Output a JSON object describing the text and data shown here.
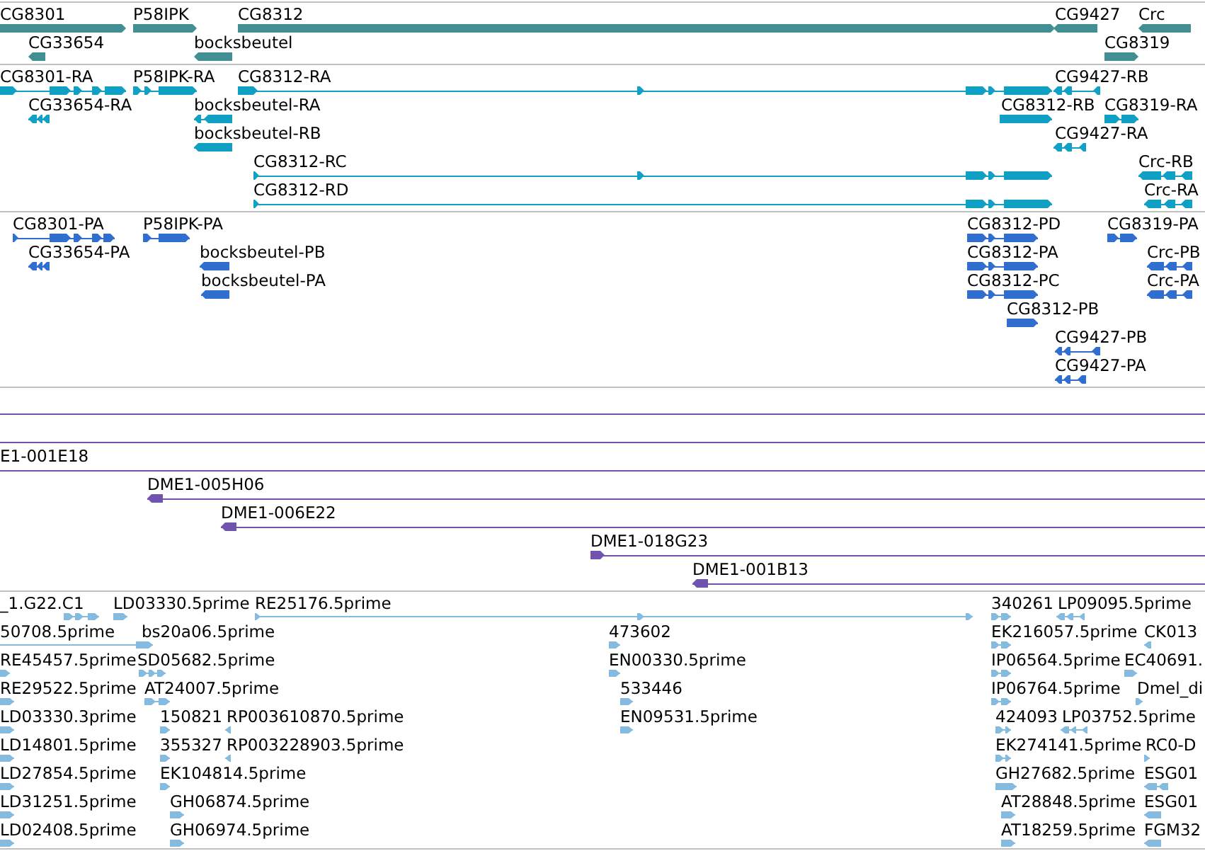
{
  "tracks": [
    {
      "kind": "gene",
      "color": "#418f92",
      "features": [
        {
          "label": "CG8301",
          "reverse": false
        },
        {
          "label": "P58IPK",
          "reverse": false
        },
        {
          "label": "CG8312",
          "reverse": false
        },
        {
          "label": "CG9427",
          "reverse": true
        },
        {
          "label": "Crc",
          "reverse": true
        },
        {
          "label": "CG33654",
          "reverse": true
        },
        {
          "label": "bocksbeutel",
          "reverse": true
        },
        {
          "label": "CG8319",
          "reverse": false
        }
      ]
    },
    {
      "kind": "transcript",
      "color": "#10a0c4",
      "features": [
        {
          "label": "CG8301-RA",
          "reverse": false
        },
        {
          "label": "P58IPK-RA",
          "reverse": false
        },
        {
          "label": "CG8312-RA",
          "reverse": false
        },
        {
          "label": "CG9427-RB",
          "reverse": true
        },
        {
          "label": "CG33654-RA",
          "reverse": true
        },
        {
          "label": "bocksbeutel-RA",
          "reverse": true
        },
        {
          "label": "CG8312-RB",
          "reverse": false
        },
        {
          "label": "CG8319-RA",
          "reverse": false
        },
        {
          "label": "bocksbeutel-RB",
          "reverse": true
        },
        {
          "label": "CG9427-RA",
          "reverse": true
        },
        {
          "label": "CG8312-RC",
          "reverse": false
        },
        {
          "label": "Crc-RB",
          "reverse": true
        },
        {
          "label": "CG8312-RD",
          "reverse": false
        },
        {
          "label": "Crc-RA",
          "reverse": true
        }
      ]
    },
    {
      "kind": "protein",
      "color": "#306ed0",
      "features": [
        {
          "label": "CG8301-PA",
          "reverse": false
        },
        {
          "label": "P58IPK-PA",
          "reverse": false
        },
        {
          "label": "CG8312-PD",
          "reverse": false
        },
        {
          "label": "CG8319-PA",
          "reverse": false
        },
        {
          "label": "CG33654-PA",
          "reverse": true
        },
        {
          "label": "bocksbeutel-PB",
          "reverse": true
        },
        {
          "label": "CG8312-PA",
          "reverse": false
        },
        {
          "label": "Crc-PB",
          "reverse": true
        },
        {
          "label": "bocksbeutel-PA",
          "reverse": true
        },
        {
          "label": "CG8312-PC",
          "reverse": false
        },
        {
          "label": "Crc-PA",
          "reverse": true
        },
        {
          "label": "CG8312-PB",
          "reverse": false
        },
        {
          "label": "CG9427-PB",
          "reverse": true
        },
        {
          "label": "CG9427-PA",
          "reverse": true
        }
      ]
    },
    {
      "kind": "clone",
      "color": "#7054b0",
      "features": [
        {
          "label": "E1-001E18"
        },
        {
          "label": "DME1-005H06",
          "reverse": true
        },
        {
          "label": "DME1-006E22",
          "reverse": true
        },
        {
          "label": "DME1-018G23",
          "reverse": false
        },
        {
          "label": "DME1-001B13",
          "reverse": true
        }
      ]
    },
    {
      "kind": "est",
      "color": "#86bbe0",
      "features": [
        {
          "label": "_1.G22.C1",
          "reverse": false
        },
        {
          "label": "LD03330.5prime",
          "reverse": false
        },
        {
          "label": "RE25176.5prime",
          "reverse": false
        },
        {
          "label": "340261",
          "reverse": false
        },
        {
          "label": "LP09095.5prime",
          "reverse": true
        },
        {
          "label": "50708.5prime",
          "reverse": false
        },
        {
          "label": "bs20a06.5prime"
        },
        {
          "label": "473602",
          "reverse": false
        },
        {
          "label": "EK216057.5prime",
          "reverse": false
        },
        {
          "label": "CK013",
          "reverse": true
        },
        {
          "label": "RE45457.5prime",
          "reverse": false
        },
        {
          "label": "SD05682.5prime",
          "reverse": false
        },
        {
          "label": "EN00330.5prime",
          "reverse": false
        },
        {
          "label": "IP06564.5prime",
          "reverse": false
        },
        {
          "label": "EC40691.",
          "reverse": false
        },
        {
          "label": "RE29522.5prime",
          "reverse": false
        },
        {
          "label": "AT24007.5prime",
          "reverse": false
        },
        {
          "label": "533446",
          "reverse": false
        },
        {
          "label": "IP06764.5prime",
          "reverse": false
        },
        {
          "label": "Dmel_di",
          "reverse": false
        },
        {
          "label": "LD03330.3prime",
          "reverse": false
        },
        {
          "label": "150821",
          "reverse": false
        },
        {
          "label": "RP003610870.5prime",
          "reverse": true
        },
        {
          "label": "EN09531.5prime",
          "reverse": false
        },
        {
          "label": "424093",
          "reverse": false
        },
        {
          "label": "LP03752.5prime",
          "reverse": true
        },
        {
          "label": "LD14801.5prime",
          "reverse": false
        },
        {
          "label": "355327",
          "reverse": false
        },
        {
          "label": "RP003228903.5prime",
          "reverse": true
        },
        {
          "label": "EK274141.5prime",
          "reverse": false
        },
        {
          "label": "RC0-D",
          "reverse": false
        },
        {
          "label": "LD27854.5prime",
          "reverse": false
        },
        {
          "label": "EK104814.5prime",
          "reverse": false
        },
        {
          "label": "GH27682.5prime",
          "reverse": false
        },
        {
          "label": "ESG01",
          "reverse": true
        },
        {
          "label": "LD31251.5prime",
          "reverse": false
        },
        {
          "label": "GH06874.5prime",
          "reverse": false
        },
        {
          "label": "AT28848.5prime",
          "reverse": false
        },
        {
          "label": "ESG01",
          "reverse": true
        },
        {
          "label": "LD02408.5prime",
          "reverse": false
        },
        {
          "label": "GH06974.5prime",
          "reverse": false
        },
        {
          "label": "AT18259.5prime",
          "reverse": false
        },
        {
          "label": "FGM32",
          "reverse": true
        }
      ]
    }
  ]
}
